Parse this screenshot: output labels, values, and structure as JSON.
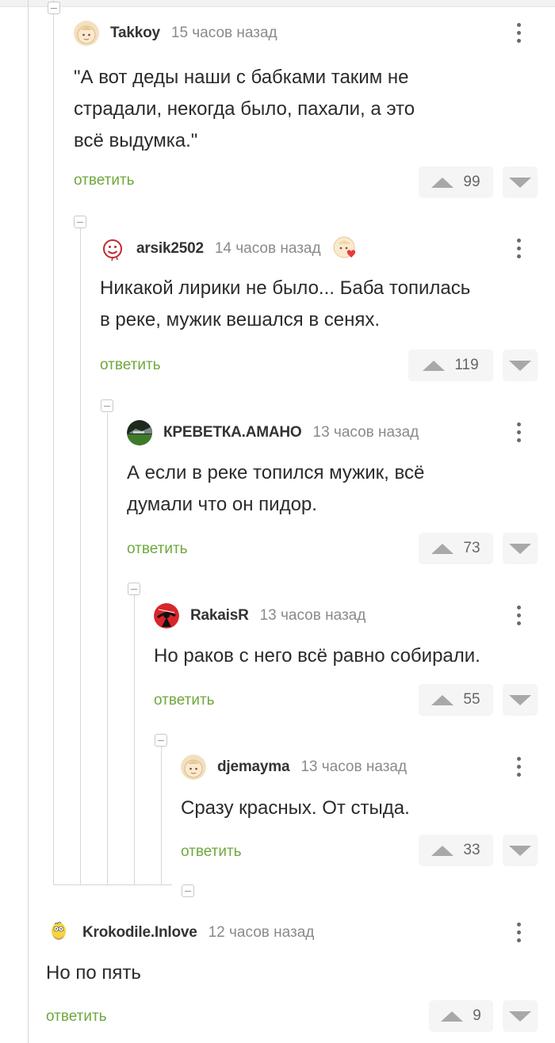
{
  "comments": [
    {
      "username": "Takkoy",
      "time": "15 часов назад",
      "lines": [
        "\"А вот деды наши с бабками таким не",
        "страдали, некогда было, пахали, а это",
        "всё выдумка.\""
      ],
      "reply_label": "ответить",
      "rating": "99",
      "avatar": "baby-face-avatar"
    },
    {
      "username": "arsik2502",
      "time": "14 часов назад",
      "lines": [
        "Никакой лирики не было... Баба топилась",
        "в реке, мужик вешался в сенях."
      ],
      "reply_label": "ответить",
      "rating": "119",
      "avatar": "red-smiley-avatar",
      "badge": "baby-heart-badge"
    },
    {
      "username": "КРЕВЕТКА.АМАНО",
      "time": "13 часов назад",
      "lines": [
        "А если в реке топился мужик, всё",
        "думали что он пидор."
      ],
      "reply_label": "ответить",
      "rating": "73",
      "avatar": "dark-landscape-avatar"
    },
    {
      "username": "RakaisR",
      "time": "13 часов назад",
      "lines": [
        "Но раков с него всё равно собирали."
      ],
      "reply_label": "ответить",
      "rating": "55",
      "avatar": "red-ninja-avatar"
    },
    {
      "username": "djemayma",
      "time": "13 часов назад",
      "lines": [
        "Сразу красных. От стыда."
      ],
      "reply_label": "ответить",
      "rating": "33",
      "avatar": "baby-face-avatar"
    },
    {
      "username": "Krokodile.Inlove",
      "time": "12 часов назад",
      "lines": [
        "Но по пять"
      ],
      "reply_label": "ответить",
      "rating": "9",
      "avatar": "homer-avatar"
    }
  ],
  "colors": {
    "reply": "#6fa83d",
    "username": "#333333",
    "time": "#8a8a8a",
    "vote_bg": "#f5f5f5",
    "thread_line": "#d6d6d6"
  }
}
